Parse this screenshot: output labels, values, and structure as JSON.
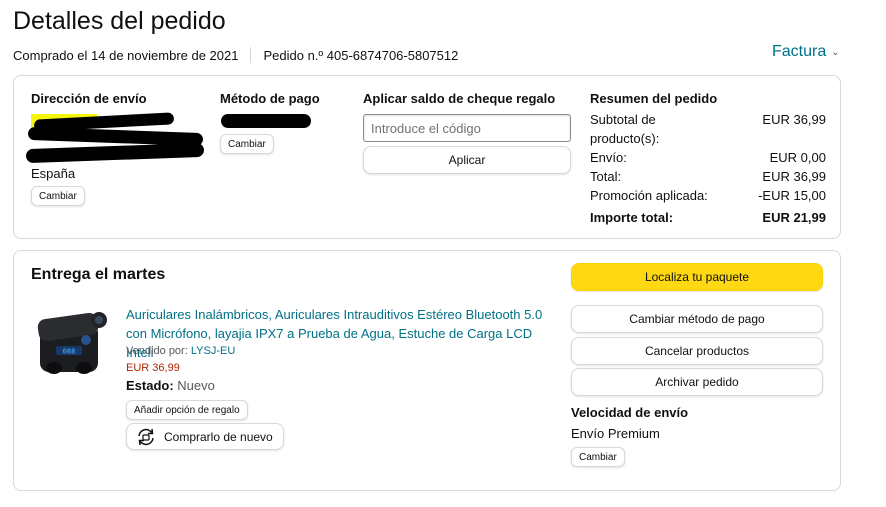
{
  "header": {
    "title": "Detalles del pedido",
    "ordered_on": "Comprado el 14 de noviembre de 2021",
    "order_number": "Pedido n.º 405-6874706-5807512",
    "invoice_label": "Factura"
  },
  "shipping": {
    "heading": "Dirección de envío",
    "country": "España",
    "change_label": "Cambiar"
  },
  "payment": {
    "heading": "Método de pago",
    "change_label": "Cambiar"
  },
  "gift_card": {
    "heading": "Aplicar saldo de cheque regalo",
    "placeholder": "Introduce el código",
    "apply_label": "Aplicar"
  },
  "summary": {
    "heading": "Resumen del pedido",
    "rows": [
      {
        "label": "Subtotal de producto(s):",
        "value": "EUR 36,99"
      },
      {
        "label": "Envío:",
        "value": "EUR 0,00"
      },
      {
        "label": "Total:",
        "value": "EUR 36,99"
      },
      {
        "label": "Promoción aplicada:",
        "value": "-EUR 15,00"
      }
    ],
    "grand_total_label": "Importe total:",
    "grand_total_value": "EUR 21,99"
  },
  "delivery": {
    "heading": "Entrega el martes",
    "product_title": "Auriculares Inalámbricos, Auriculares Intrauditivos Estéreo Bluetooth 5.0 con Micrófono, layajia IPX7 a Prueba de Agua, Estuche de Carga LCD Inteli",
    "seller_prefix": "Vendido por:",
    "seller_name": "LYSJ-EU",
    "price": "EUR 36,99",
    "status_label": "Estado:",
    "status_value": "Nuevo",
    "gift_option_label": "Añadir opción de regalo",
    "rebuy_label": "Comprarlo de nuevo"
  },
  "actions": {
    "track": "Localiza tu paquete",
    "change_payment": "Cambiar método de pago",
    "cancel": "Cancelar productos",
    "archive": "Archivar pedido"
  },
  "shipping_speed": {
    "heading": "Velocidad de envío",
    "value": "Envío Premium",
    "change_label": "Cambiar"
  },
  "colors": {
    "link": "#007185",
    "primary_button": "#ffd814",
    "price": "#b12704"
  }
}
